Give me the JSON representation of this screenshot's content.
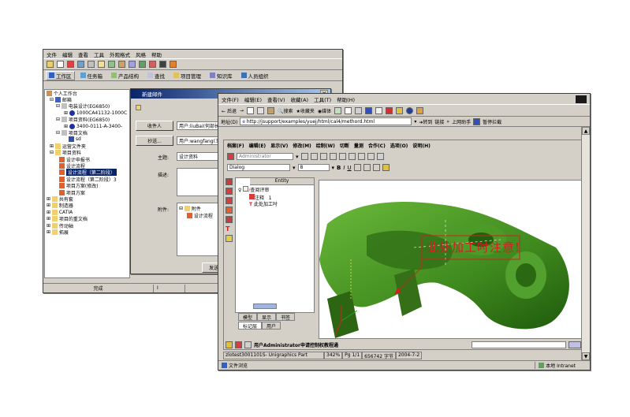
{
  "win1": {
    "menu": [
      "文件",
      "编辑",
      "查看",
      "工具",
      "外观格式",
      "风格",
      "帮助"
    ],
    "tabs": [
      "工作区",
      "任务箱",
      "产品结构",
      "查找",
      "项目管理",
      "知识库",
      "人员组织"
    ],
    "tree": [
      "个人工作台",
      "邮箱",
      "电装设计(EG6850)",
      "1000CA41132-1000C",
      "项目资料(EG6850)",
      "3400-0111-A-3400-",
      "项目文档",
      "sd",
      "运营文件夹",
      "项目资料",
      "设计申报书",
      "设计流程",
      "设计流程（第二阶段）",
      "设计流程（第二阶段）3",
      "项目方案(修改)",
      "项目方案",
      "共有套",
      "制造器",
      "CATIA",
      "项目的重文档",
      "传动轴",
      "拓展"
    ],
    "status": [
      "完成",
      "I"
    ]
  },
  "dialog": {
    "title": "新建邮件",
    "btn_recipient": "收件人",
    "recipient_value": "用户:liuBai(何部长",
    "btn_cc": "抄送...",
    "cc_value": "用户:wangfang(王",
    "label_subject": "主题:",
    "subject_value": "设计资料",
    "label_desc": "描述:",
    "label_attach": "附件:",
    "attach_items": [
      "附件",
      "设计流程"
    ],
    "btn_send": "发送"
  },
  "win2": {
    "menu": [
      "文件(F)",
      "编辑(E)",
      "查看(V)",
      "收藏(A)",
      "工具(T)",
      "帮助(H)"
    ],
    "nav": [
      "后退",
      "搜索",
      "收藏夹",
      "媒体"
    ],
    "address_label": "地址(D)",
    "address_value": "http://jsupport/examples/yuej/html/cal4/methord.html",
    "go_label": "转到",
    "links_label": "链接",
    "misc_links": [
      "上网助手",
      "暂停拦截"
    ],
    "app_menu": [
      "档案(F)",
      "编辑(E)",
      "显示(V)",
      "修改(M)",
      "绘制(W)",
      "切断",
      "量测",
      "合作(C)",
      "选项(O)",
      "说明(H)"
    ],
    "user_combo": "Administrator",
    "font_combo": "Dialog",
    "size_combo": "8",
    "entity_header": "Entity",
    "entity_tree": [
      "查阅评审",
      "注释",
      "此处加工吋"
    ],
    "entity_count": "1",
    "annotation": "此处加工吋注意!",
    "panel_tabs_row1": [
      "模型",
      "显示",
      "书签"
    ],
    "panel_tabs_row2": [
      "标记层",
      "用户"
    ],
    "chat_text": "用户Administrator申请控制权教程通",
    "status_cells": [
      "zlotest3001101S- Unigraphics Part",
      "342%",
      "Pg 1/1",
      "656742 字节",
      "2004-7-2"
    ],
    "ie_status": "文件浏览",
    "ie_zone": "本地 Intranet"
  },
  "colors": {
    "model_green": "#3f8a1e",
    "annotation_red": "#d02020"
  }
}
